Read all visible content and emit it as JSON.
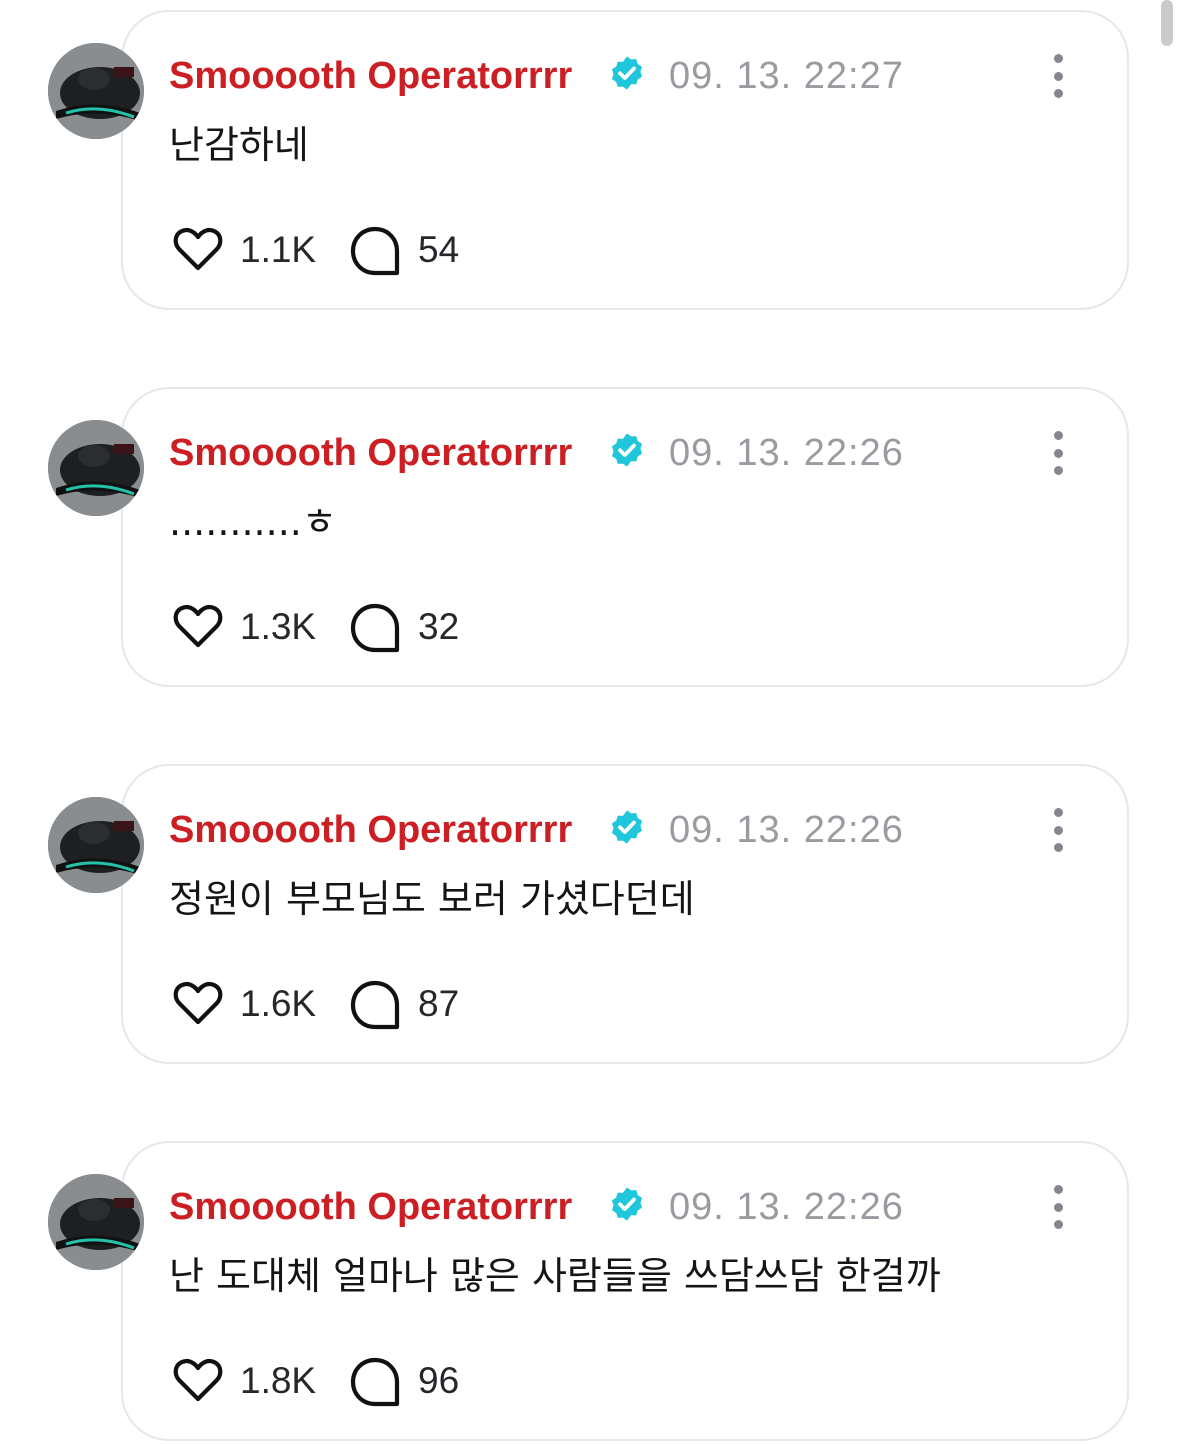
{
  "comments": [
    {
      "username": "Smooooth Operatorrrr",
      "timestamp": "09. 13. 22:27",
      "text": "난감하네",
      "likes": "1.1K",
      "replies": "54"
    },
    {
      "username": "Smooooth Operatorrrr",
      "timestamp": "09. 13. 22:26",
      "text": "...........ㅎ",
      "likes": "1.3K",
      "replies": "32"
    },
    {
      "username": "Smooooth Operatorrrr",
      "timestamp": "09. 13. 22:26",
      "text": "정원이 부모님도 보러 가셨다던데",
      "likes": "1.6K",
      "replies": "87"
    },
    {
      "username": "Smooooth Operatorrrr",
      "timestamp": "09. 13. 22:26",
      "text": "난 도대체 얼마나 많은 사람들을 쓰담쓰담 한걸까",
      "likes": "1.8K",
      "replies": "96"
    }
  ],
  "icons": {
    "verified": "verified-badge-icon",
    "more": "more-vertical-icon",
    "like": "heart-outline-icon",
    "reply": "speech-bubble-icon"
  },
  "colors": {
    "username": "#cc1f24",
    "verified": "#1fc6dc",
    "timestamp": "#9a9ba0",
    "card_border": "#e6e7eb",
    "text": "#151518"
  }
}
